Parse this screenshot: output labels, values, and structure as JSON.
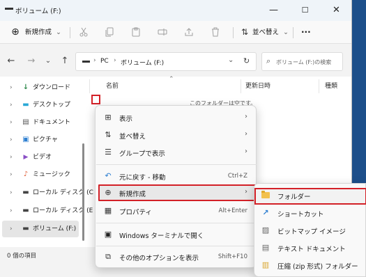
{
  "window": {
    "title": "ボリューム (F:)",
    "min_glyph": "—",
    "max_glyph": "☐",
    "close_glyph": "✕"
  },
  "toolbar": {
    "new_glyph": "⊕",
    "new_label": "新規作成",
    "new_chevron": "⌄",
    "sort_glyph": "⇅",
    "sort_label": "並べ替え",
    "sort_chevron": "⌄",
    "more_glyph": "···"
  },
  "address": {
    "back_glyph": "←",
    "forward_glyph": "→",
    "down_glyph": "⌄",
    "up_glyph": "↑",
    "sep1": "›",
    "crumb_pc": "PC",
    "sep2": "›",
    "crumb_volume": "ボリューム (F:)",
    "dropdown_glyph": "⌄",
    "refresh_glyph": "↻",
    "search_glyph": "⌕",
    "search_placeholder": "ボリューム (F:)の検索"
  },
  "columns": {
    "name": "名前",
    "date": "更新日時",
    "type": "種類",
    "sort_glyph": "⌃"
  },
  "empty_message": "このフォルダーは空です。",
  "sidebar": {
    "items": [
      {
        "label": "ダウンロード",
        "icon": "↓",
        "color": "#2f8a4c"
      },
      {
        "label": "デスクトップ",
        "icon": "▬",
        "color": "#2aa8d6"
      },
      {
        "label": "ドキュメント",
        "icon": "▤",
        "color": "#555555"
      },
      {
        "label": "ピクチャ",
        "icon": "▣",
        "color": "#2d7fd1"
      },
      {
        "label": "ビデオ",
        "icon": "▶",
        "color": "#8a4fc5"
      },
      {
        "label": "ミュージック",
        "icon": "♪",
        "color": "#e0603a"
      },
      {
        "label": "ローカル ディスク (C",
        "icon": "▬",
        "color": "#444444"
      },
      {
        "label": "ローカル ディスク (E",
        "icon": "▬",
        "color": "#444444"
      },
      {
        "label": "ボリューム (F:)",
        "icon": "▬",
        "color": "#444444"
      }
    ],
    "chevron": "›"
  },
  "status": {
    "text": "0 個の項目"
  },
  "context_menu": {
    "items": [
      {
        "label": "表示",
        "icon": "⊞",
        "arrow": "›"
      },
      {
        "label": "並べ替え",
        "icon": "⇅",
        "arrow": "›"
      },
      {
        "label": "グループで表示",
        "icon": "☰",
        "arrow": "›"
      },
      {
        "label": "元に戻す - 移動",
        "icon": "↶",
        "shortcut": "Ctrl+Z"
      },
      {
        "label": "新規作成",
        "icon": "⊕",
        "arrow": "›"
      },
      {
        "label": "プロパティ",
        "icon": "▦",
        "shortcut": "Alt+Enter"
      },
      {
        "label": "Windows ターミナルで開く",
        "icon": "▣"
      },
      {
        "label": "その他のオプションを表示",
        "icon": "⧉",
        "shortcut": "Shift+F10"
      }
    ]
  },
  "submenu": {
    "items": [
      {
        "label": "フォルダー",
        "icon": "folder"
      },
      {
        "label": "ショートカット",
        "icon": "↗"
      },
      {
        "label": "ビットマップ イメージ",
        "icon": "▨"
      },
      {
        "label": "テキスト ドキュメント",
        "icon": "▤"
      },
      {
        "label": "圧縮 (zip 形式) フォルダー",
        "icon": "▥"
      }
    ]
  },
  "colors": {
    "highlight_border": "#d32027",
    "accent": "#0067c0"
  }
}
